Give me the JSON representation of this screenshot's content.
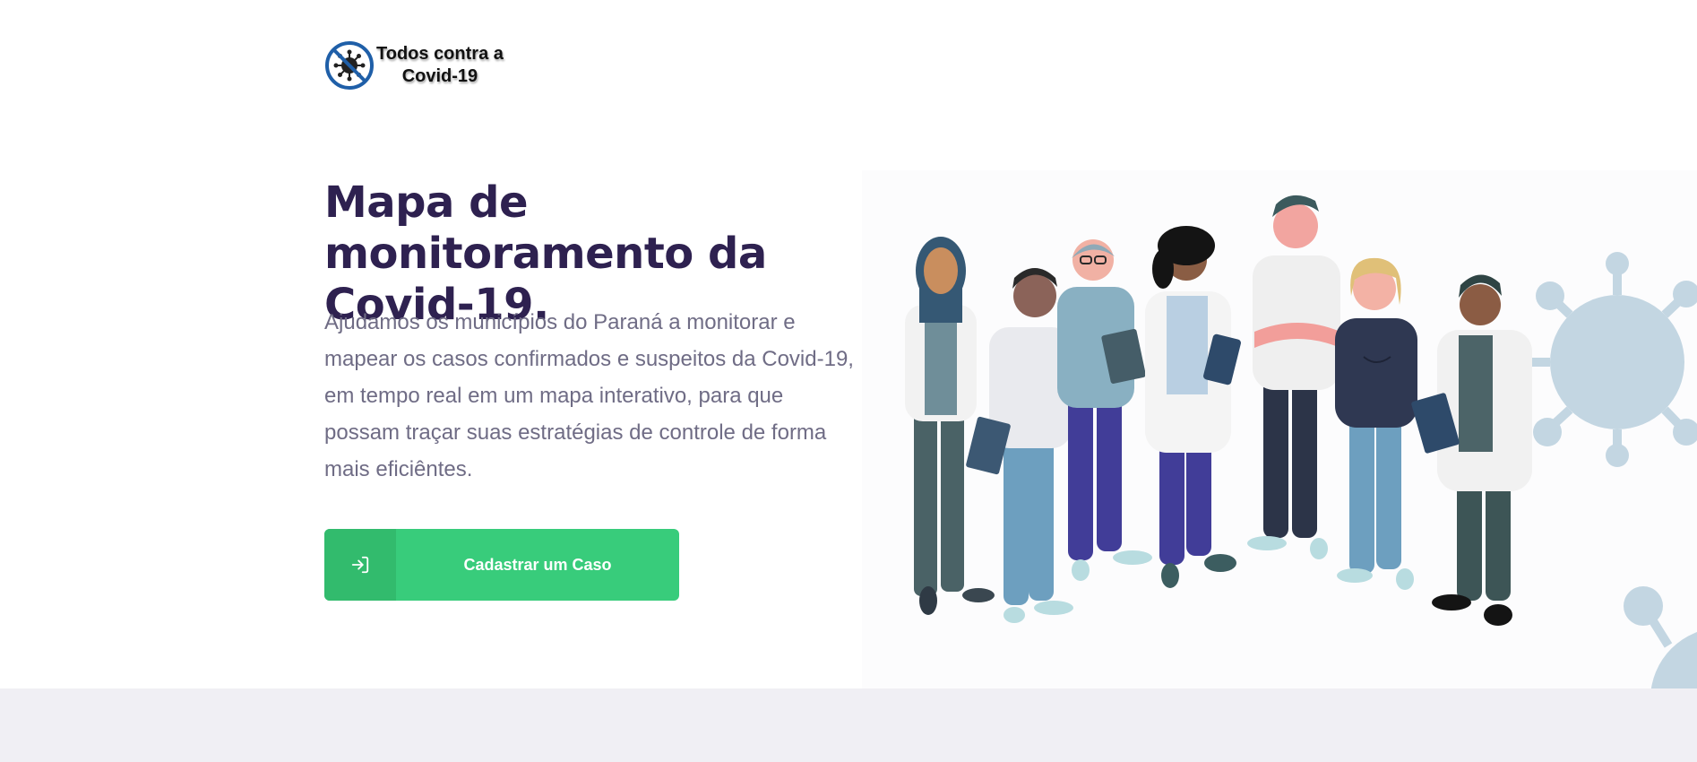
{
  "logo": {
    "line1": "Todos contra a",
    "line2": "Covid-19",
    "icon": "virus-prohibited-icon"
  },
  "hero": {
    "title": "Mapa de monitoramento da Covid-19.",
    "description": "Ajudamos os municípios do Paraná a monitorar e mapear os casos confirmados e suspeitos da Covid-19, em tempo real em um mapa interativo, para que possam traçar suas estratégias de controle de forma mais eficiêntes.",
    "cta_label": "Cadastrar um Caso",
    "cta_icon": "sign-in-icon"
  },
  "illustration": {
    "subject": "healthcare-workers-group",
    "virus_icon": "virus-icon"
  },
  "colors": {
    "title": "#2e2150",
    "text": "#6f6c85",
    "cta": "#38cc7b",
    "cta_dark": "#32bb6d",
    "virus": "#c3d6e2",
    "band": "#f0eff4"
  }
}
